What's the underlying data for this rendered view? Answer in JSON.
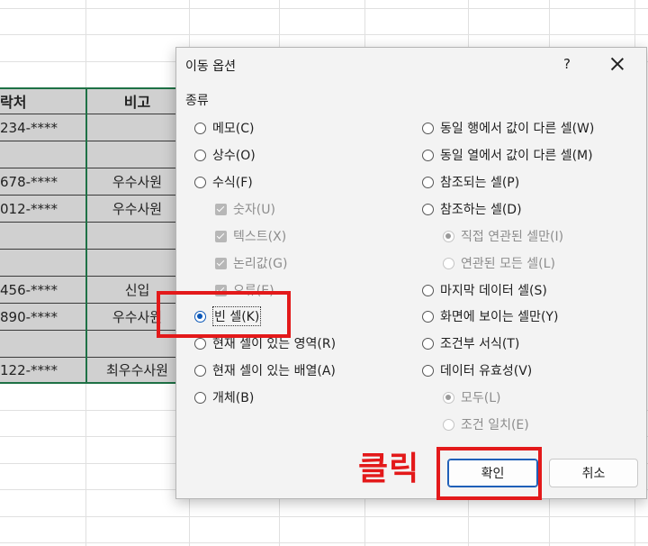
{
  "sheet": {
    "header": [
      "락처",
      "비고"
    ],
    "rows": [
      [
        "234-****",
        ""
      ],
      [
        "",
        ""
      ],
      [
        "678-****",
        "우수사원"
      ],
      [
        "012-****",
        "우수사원"
      ],
      [
        "",
        ""
      ],
      [
        "",
        ""
      ],
      [
        "456-****",
        "신입"
      ],
      [
        "890-****",
        "우수사원"
      ],
      [
        "",
        ""
      ],
      [
        "122-****",
        "최우수사원"
      ]
    ]
  },
  "dialog": {
    "title": "이동 옵션",
    "help": "?",
    "group_label": "종류",
    "left_options": {
      "memo": "메모(C)",
      "constant": "상수(O)",
      "formula": "수식(F)",
      "number": "숫자(U)",
      "text": "텍스트(X)",
      "logical": "논리값(G)",
      "error": "오류(E)",
      "blanks": "빈 셀(K)",
      "current_region": "현재 셀이 있는 영역(R)",
      "current_array": "현재 셀이 있는 배열(A)",
      "objects": "개체(B)"
    },
    "right_options": {
      "row_diff": "동일 행에서 값이 다른 셀(W)",
      "col_diff": "동일 열에서 값이 다른 셀(M)",
      "precedents": "참조되는 셀(P)",
      "dependents": "참조하는 셀(D)",
      "direct_only": "직접 연관된 셀만(I)",
      "all_levels": "연관된 모든 셀(L)",
      "last_cell": "마지막 데이터 셀(S)",
      "visible_only": "화면에 보이는 셀만(Y)",
      "conditional_formats": "조건부 서식(T)",
      "data_validation": "데이터 유효성(V)",
      "all": "모두(L)",
      "same": "조건 일치(E)"
    },
    "ok": "확인",
    "cancel": "취소"
  },
  "annotation": {
    "click_text": "클릭",
    "color": "#e3191a"
  },
  "colors": {
    "accent": "#0a57b8",
    "selection_border": "#1e7145",
    "cell_fill": "#d0d0d0"
  }
}
